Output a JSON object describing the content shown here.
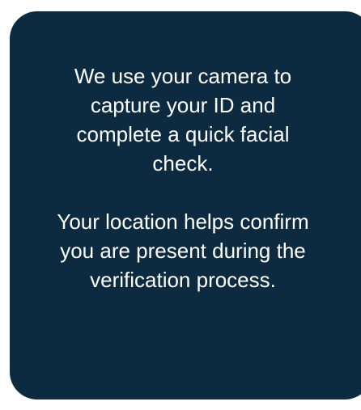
{
  "info_card": {
    "camera_text": "We use your camera to capture your ID and complete a quick facial check.",
    "location_text": "Your location helps confirm you are present during the verification process."
  },
  "colors": {
    "card_background": "#0d2b40",
    "text": "#ffffff",
    "page_background": "#ffffff"
  }
}
